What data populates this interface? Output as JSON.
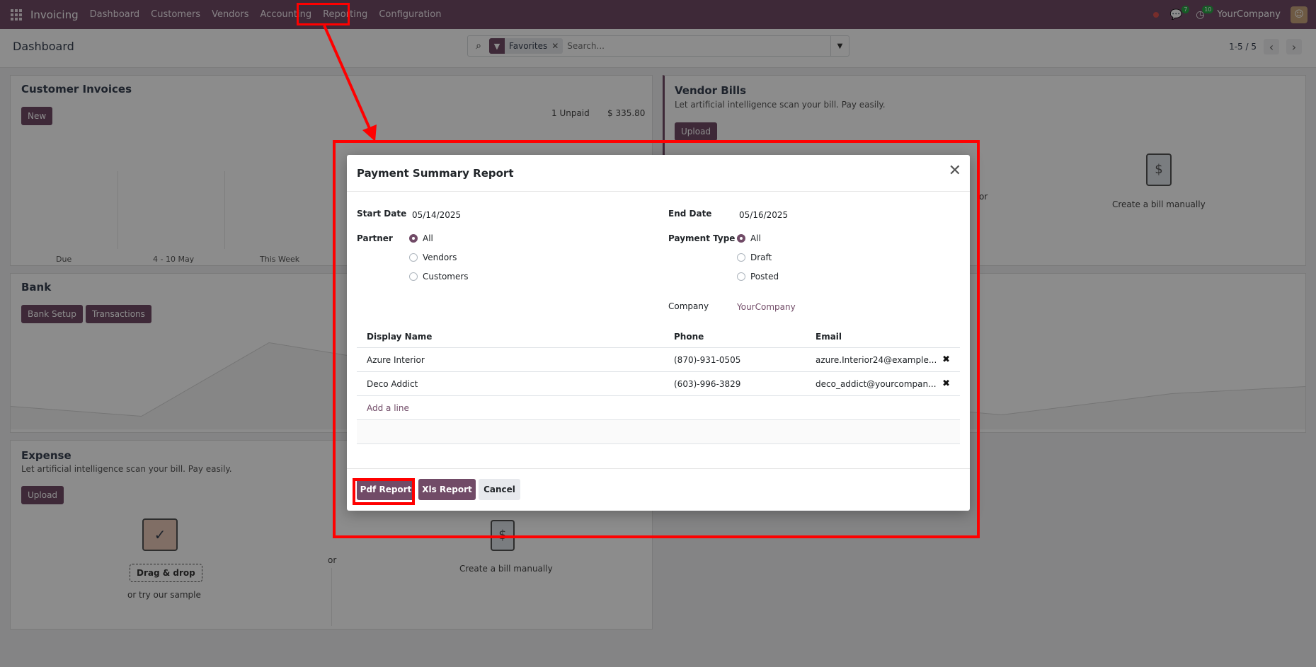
{
  "navbar": {
    "app_name": "Invoicing",
    "menu": [
      "Dashboard",
      "Customers",
      "Vendors",
      "Accounting",
      "Reporting",
      "Configuration"
    ],
    "chat_badge": "7",
    "activity_badge": "10",
    "company": "YourCompany"
  },
  "control_panel": {
    "title": "Dashboard",
    "facet_label": "Favorites",
    "search_placeholder": "Search...",
    "pager": "1-5 / 5"
  },
  "cards": {
    "customer_invoices": {
      "title": "Customer Invoices",
      "new_button": "New",
      "unpaid_label": "1 Unpaid",
      "unpaid_amount": "$ 335.80",
      "chart_labels": [
        "Due",
        "4 - 10 May",
        "This Week"
      ]
    },
    "vendor_bills": {
      "title": "Vendor Bills",
      "subtitle": "Let artificial intelligence scan your bill. Pay easily.",
      "upload_button": "Upload",
      "or_text": "or",
      "create_manual": "Create a bill manually"
    },
    "bank": {
      "title": "Bank",
      "setup_button": "Bank Setup",
      "transactions_button": "Transactions"
    },
    "expense": {
      "title": "Expense",
      "subtitle": "Let artificial intelligence scan your bill. Pay easily.",
      "upload_button": "Upload",
      "drag_drop": "Drag & drop",
      "or_text": "or",
      "try_sample": "try our sample",
      "create_manual": "Create a bill manually"
    }
  },
  "modal": {
    "title": "Payment Summary Report",
    "start_date_label": "Start Date",
    "start_date": "05/14/2025",
    "end_date_label": "End Date",
    "end_date": "05/16/2025",
    "partner_label": "Partner",
    "partner_options": [
      "All",
      "Vendors",
      "Customers"
    ],
    "partner_selected": "All",
    "payment_type_label": "Payment Type",
    "payment_type_options": [
      "All",
      "Draft",
      "Posted"
    ],
    "payment_type_selected": "All",
    "company_label": "Company",
    "company_value": "YourCompany",
    "table": {
      "headers": [
        "Display Name",
        "Phone",
        "Email"
      ],
      "rows": [
        {
          "name": "Azure Interior",
          "phone": "(870)-931-0505",
          "email": "azure.Interior24@example...."
        },
        {
          "name": "Deco Addict",
          "phone": "(603)-996-3829",
          "email": "deco_addict@yourcompan..."
        }
      ],
      "add_line": "Add a line"
    },
    "buttons": {
      "pdf": "Pdf Report",
      "xls": "Xls Report",
      "cancel": "Cancel"
    }
  },
  "colors": {
    "brand": "#714b67",
    "annotation": "#ff0000"
  }
}
